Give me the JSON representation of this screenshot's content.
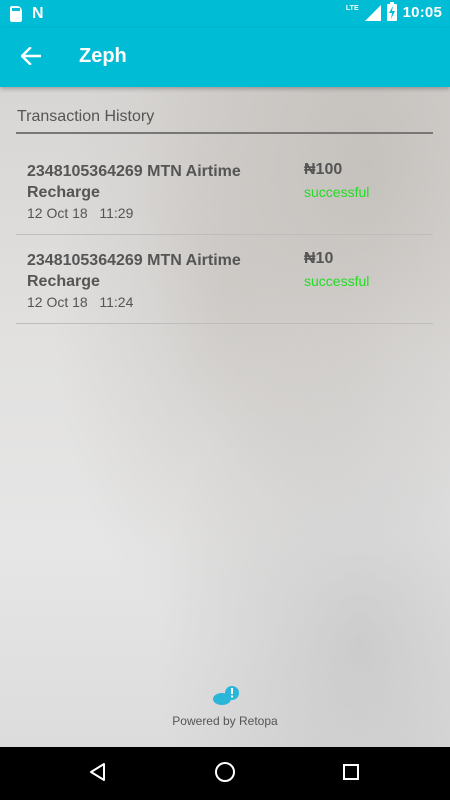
{
  "status_bar": {
    "time": "10:05",
    "network_label": "LTE",
    "icons": [
      "sd-card-icon",
      "n-notification-icon",
      "signal-icon",
      "battery-charging-icon"
    ]
  },
  "app_bar": {
    "title": "Zeph",
    "back_icon": "arrow-back-icon"
  },
  "section": {
    "title": "Transaction History"
  },
  "transactions": [
    {
      "description": "2348105364269 MTN Airtime Recharge",
      "date": "12 Oct 18",
      "time": "11:29",
      "amount": "₦100",
      "status": "successful"
    },
    {
      "description": "2348105364269 MTN Airtime Recharge",
      "date": "12 Oct 18",
      "time": "11:24",
      "amount": "₦10",
      "status": "successful"
    }
  ],
  "footer": {
    "powered_by": "Powered by Retopa",
    "logo_icon": "retopa-logo-icon"
  },
  "nav_bar": {
    "icons": [
      "back-triangle-icon",
      "home-circle-icon",
      "recents-square-icon"
    ]
  },
  "colors": {
    "accent": "#00bcd4",
    "success": "#22dd22",
    "text": "#555555"
  }
}
